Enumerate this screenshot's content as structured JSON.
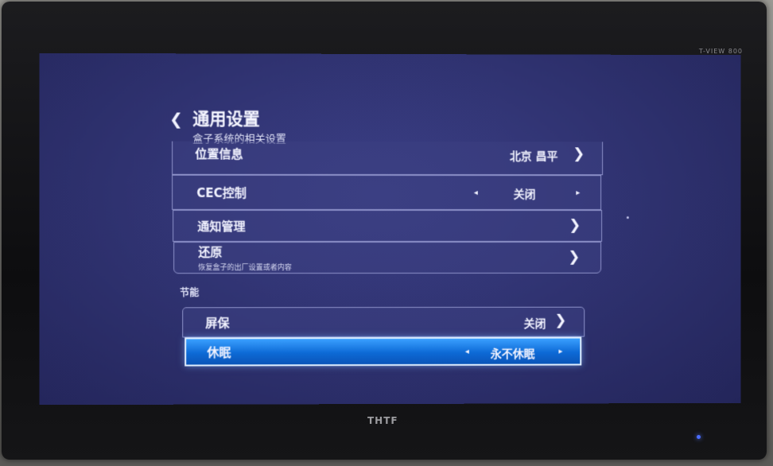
{
  "tv": {
    "brand": "THTF",
    "brand_top": "T-VIEW 800"
  },
  "header": {
    "back_icon": "chevron-left-icon",
    "title": "通用设置",
    "subtitle": "盒子系统的相关设置"
  },
  "settings": {
    "location": {
      "label": "位置信息",
      "value": "北京 昌平"
    },
    "cec": {
      "label": "CEC控制",
      "value": "关闭"
    },
    "notifications": {
      "label": "通知管理"
    },
    "restore": {
      "label": "还原",
      "description": "恢复盒子的出厂设置或者内容"
    }
  },
  "power_section": {
    "title": "节能",
    "screensaver": {
      "label": "屏保",
      "value": "关闭"
    },
    "sleep": {
      "label": "休眠",
      "value": "永不休眠"
    }
  },
  "colors": {
    "screen_bg": "#2f3270",
    "selected_row": "#0d6ad6",
    "row_border": "#8d91c9"
  }
}
